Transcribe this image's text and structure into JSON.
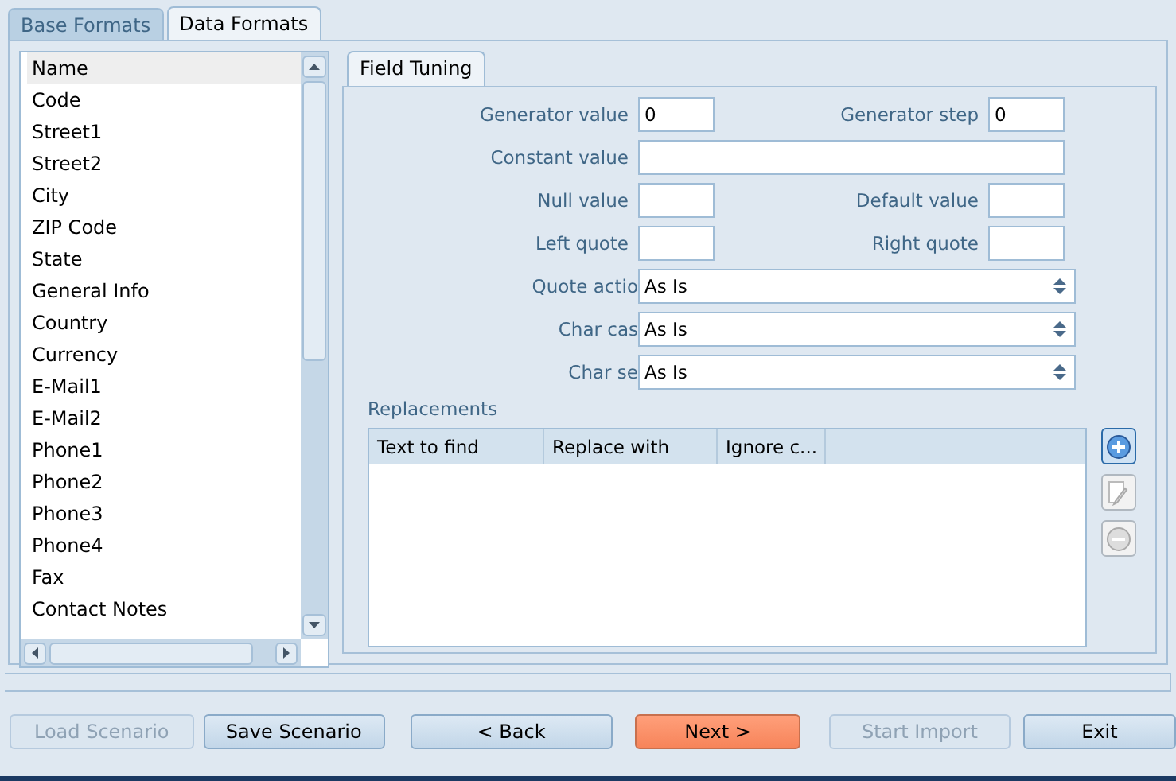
{
  "tabs": [
    {
      "label": "Base Formats",
      "selected": false
    },
    {
      "label": "Data Formats",
      "selected": true
    }
  ],
  "fields": [
    {
      "name": "Name",
      "selected": true
    },
    {
      "name": "Code",
      "selected": false
    },
    {
      "name": "Street1",
      "selected": false
    },
    {
      "name": "Street2",
      "selected": false
    },
    {
      "name": "City",
      "selected": false
    },
    {
      "name": "ZIP Code",
      "selected": false
    },
    {
      "name": "State",
      "selected": false
    },
    {
      "name": "General Info",
      "selected": false
    },
    {
      "name": "Country",
      "selected": false
    },
    {
      "name": "Currency",
      "selected": false
    },
    {
      "name": "E-Mail1",
      "selected": false
    },
    {
      "name": "E-Mail2",
      "selected": false
    },
    {
      "name": "Phone1",
      "selected": false
    },
    {
      "name": "Phone2",
      "selected": false
    },
    {
      "name": "Phone3",
      "selected": false
    },
    {
      "name": "Phone4",
      "selected": false
    },
    {
      "name": "Fax",
      "selected": false
    },
    {
      "name": "Contact Notes",
      "selected": false
    }
  ],
  "inner_tab": {
    "label": "Field Tuning",
    "selected": true
  },
  "generator_value": {
    "label": "Generator value",
    "value": "0"
  },
  "generator_step": {
    "label": "Generator step",
    "value": "0"
  },
  "constant_value": {
    "label": "Constant value"
  },
  "null_value": {
    "label": "Null value"
  },
  "default_value": {
    "label": "Default value"
  },
  "left_quote": {
    "label": "Left quote"
  },
  "right_quote": {
    "label": "Right quote"
  },
  "selects": [
    {
      "label": "Quote actio",
      "value": "As Is"
    },
    {
      "label": "Char cas",
      "value": "As Is"
    },
    {
      "label": "Char se",
      "value": "As Is"
    }
  ],
  "replacements": {
    "title": "Replacements",
    "columns": [
      "Text to find",
      "Replace with",
      "Ignore c..."
    ],
    "tools": [
      {
        "kind": "add",
        "disabled": false
      },
      {
        "kind": "edit",
        "disabled": true
      },
      {
        "kind": "remove",
        "disabled": true
      }
    ]
  },
  "buttons": [
    {
      "label": "Load Scenario",
      "disabled": true,
      "kind": "normal"
    },
    {
      "label": "Save Scenario",
      "disabled": false,
      "kind": "normal"
    },
    {
      "label": "< Back",
      "disabled": false,
      "kind": "normal"
    },
    {
      "label": "Next >",
      "disabled": false,
      "kind": "primary"
    },
    {
      "label": "Start Import",
      "disabled": true,
      "kind": "normal"
    },
    {
      "label": "Exit",
      "disabled": false,
      "kind": "normal"
    }
  ]
}
